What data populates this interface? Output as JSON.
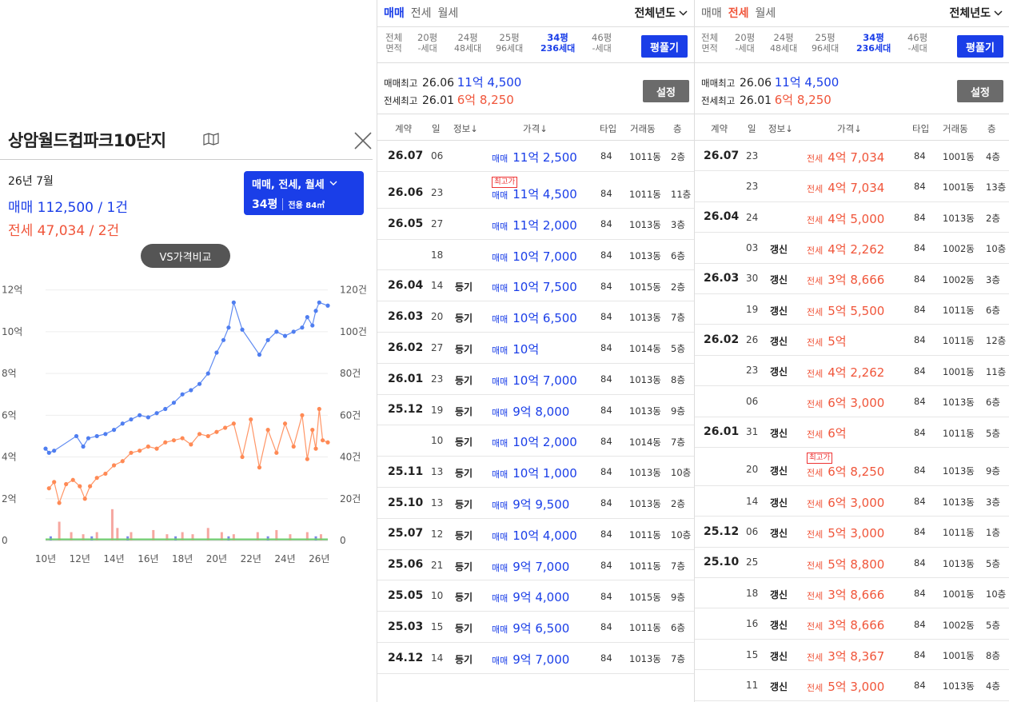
{
  "left": {
    "title": "상암월드컵파크10단지",
    "month": "26년 7월",
    "sale_summary": "매매 112,500 / 1건",
    "jeonse_summary": "전세 47,034 / 2건",
    "type_selector": {
      "label": "매매, 전세, 월세",
      "size": "34평",
      "area": "전용 84㎡"
    },
    "vs_button": "VS가격비교"
  },
  "chart_data": {
    "type": "line",
    "y_left_ticks": [
      "0",
      "2억",
      "4억",
      "6억",
      "8억",
      "10억",
      "12억"
    ],
    "y_right_ticks": [
      "0",
      "20건",
      "40건",
      "60건",
      "80건",
      "100건",
      "120건"
    ],
    "x_ticks": [
      "10년",
      "12년",
      "14년",
      "16년",
      "18년",
      "20년",
      "22년",
      "24년",
      "26년"
    ],
    "ylim_left": [
      0,
      12.6
    ],
    "ylim_right": [
      0,
      126
    ],
    "xlim": [
      2010,
      2026.5
    ],
    "grid": true,
    "colors": {
      "sale": "#4f7ef0",
      "jeonse": "#ff8a55",
      "volume_jeonse": "#f6a7a0",
      "volume_sale": "#7a88e8",
      "volume_other": "#6ccf6c"
    },
    "series": [
      {
        "key": "sale",
        "points": [
          [
            2010.0,
            4.4
          ],
          [
            2010.2,
            4.2
          ],
          [
            2010.5,
            4.3
          ],
          [
            2011.8,
            5.0
          ],
          [
            2012.2,
            4.5
          ],
          [
            2012.5,
            4.9
          ],
          [
            2013.0,
            5.0
          ],
          [
            2013.5,
            5.1
          ],
          [
            2014.0,
            5.3
          ],
          [
            2014.5,
            5.6
          ],
          [
            2015.0,
            5.8
          ],
          [
            2015.5,
            6.0
          ],
          [
            2016.0,
            5.9
          ],
          [
            2016.5,
            6.1
          ],
          [
            2017.0,
            6.3
          ],
          [
            2017.5,
            6.6
          ],
          [
            2018.0,
            7.0
          ],
          [
            2018.5,
            7.2
          ],
          [
            2019.0,
            7.5
          ],
          [
            2019.5,
            8.0
          ],
          [
            2020.0,
            9.0
          ],
          [
            2020.4,
            9.6
          ],
          [
            2020.7,
            10.2
          ],
          [
            2021.0,
            11.4
          ],
          [
            2021.5,
            10.1
          ],
          [
            2022.5,
            8.9
          ],
          [
            2023.0,
            9.6
          ],
          [
            2023.5,
            10.0
          ],
          [
            2024.0,
            9.8
          ],
          [
            2024.5,
            10.0
          ],
          [
            2025.0,
            10.2
          ],
          [
            2025.3,
            10.7
          ],
          [
            2025.6,
            10.3
          ],
          [
            2025.8,
            11.0
          ],
          [
            2026.0,
            11.4
          ],
          [
            2026.5,
            11.25
          ]
        ]
      },
      {
        "key": "jeonse",
        "points": [
          [
            2010.2,
            2.5
          ],
          [
            2010.5,
            2.8
          ],
          [
            2010.8,
            1.8
          ],
          [
            2011.2,
            2.7
          ],
          [
            2011.6,
            2.9
          ],
          [
            2012.0,
            2.6
          ],
          [
            2012.3,
            2.0
          ],
          [
            2012.6,
            2.6
          ],
          [
            2013.0,
            3.0
          ],
          [
            2013.5,
            3.2
          ],
          [
            2014.0,
            3.6
          ],
          [
            2014.5,
            3.8
          ],
          [
            2015.0,
            4.2
          ],
          [
            2015.5,
            4.3
          ],
          [
            2016.0,
            4.5
          ],
          [
            2016.5,
            4.4
          ],
          [
            2017.0,
            4.7
          ],
          [
            2017.5,
            4.8
          ],
          [
            2018.0,
            4.9
          ],
          [
            2018.5,
            4.6
          ],
          [
            2019.0,
            5.1
          ],
          [
            2019.5,
            5.0
          ],
          [
            2020.0,
            5.2
          ],
          [
            2020.5,
            5.4
          ],
          [
            2021.0,
            5.6
          ],
          [
            2021.5,
            4.0
          ],
          [
            2022.0,
            5.8
          ],
          [
            2022.5,
            3.5
          ],
          [
            2023.0,
            5.3
          ],
          [
            2023.5,
            4.2
          ],
          [
            2024.0,
            5.6
          ],
          [
            2024.5,
            4.5
          ],
          [
            2025.0,
            6.0
          ],
          [
            2025.3,
            3.9
          ],
          [
            2025.6,
            5.3
          ],
          [
            2025.8,
            4.4
          ],
          [
            2026.0,
            6.3
          ],
          [
            2026.2,
            4.8
          ],
          [
            2026.5,
            4.7
          ]
        ]
      }
    ],
    "volume": [
      {
        "x": 2010.8,
        "v": 9,
        "key": "jeonse"
      },
      {
        "x": 2011.5,
        "v": 4,
        "key": "jeonse"
      },
      {
        "x": 2012.2,
        "v": 3,
        "key": "jeonse"
      },
      {
        "x": 2013.0,
        "v": 4,
        "key": "jeonse"
      },
      {
        "x": 2013.9,
        "v": 15,
        "key": "jeonse"
      },
      {
        "x": 2014.2,
        "v": 6,
        "key": "jeonse"
      },
      {
        "x": 2015.0,
        "v": 4,
        "key": "jeonse"
      },
      {
        "x": 2016.3,
        "v": 5,
        "key": "jeonse"
      },
      {
        "x": 2017.1,
        "v": 3,
        "key": "jeonse"
      },
      {
        "x": 2018.0,
        "v": 4,
        "key": "jeonse"
      },
      {
        "x": 2018.6,
        "v": 3,
        "key": "jeonse"
      },
      {
        "x": 2019.5,
        "v": 6,
        "key": "jeonse"
      },
      {
        "x": 2020.3,
        "v": 4,
        "key": "jeonse"
      },
      {
        "x": 2021.0,
        "v": 3,
        "key": "jeonse"
      },
      {
        "x": 2022.4,
        "v": 4,
        "key": "jeonse"
      },
      {
        "x": 2023.5,
        "v": 5,
        "key": "jeonse"
      },
      {
        "x": 2024.3,
        "v": 3,
        "key": "jeonse"
      },
      {
        "x": 2025.3,
        "v": 4,
        "key": "jeonse"
      },
      {
        "x": 2026.1,
        "v": 3,
        "key": "jeonse"
      },
      {
        "x": 2010.3,
        "v": 2,
        "key": "sale"
      },
      {
        "x": 2012.7,
        "v": 2,
        "key": "sale"
      },
      {
        "x": 2014.8,
        "v": 2,
        "key": "sale"
      },
      {
        "x": 2017.6,
        "v": 2,
        "key": "sale"
      },
      {
        "x": 2020.7,
        "v": 2,
        "key": "sale"
      },
      {
        "x": 2023.0,
        "v": 2,
        "key": "sale"
      },
      {
        "x": 2025.8,
        "v": 2,
        "key": "sale"
      }
    ]
  },
  "sale_panel": {
    "tabs": [
      "매매",
      "전세",
      "월세"
    ],
    "year_select": "전체년도",
    "size_label_top": "전체",
    "size_label_bottom": "면적",
    "sizes": [
      {
        "py": "20평",
        "units": "-세대"
      },
      {
        "py": "24평",
        "units": "48세대"
      },
      {
        "py": "25평",
        "units": "96세대"
      },
      {
        "py": "34평",
        "units": "236세대"
      },
      {
        "py": "46평",
        "units": "-세대"
      }
    ],
    "area_button": "평풀기",
    "sale_high_label": "매매최고",
    "sale_high_date": "26.06",
    "sale_high_price": "11억 4,500",
    "jeonse_high_label": "전세최고",
    "jeonse_high_date": "26.01",
    "jeonse_high_price": "6억 8,250",
    "settings_button": "설정",
    "headers": [
      "계약",
      "일",
      "정보↓",
      "가격↓",
      "타입",
      "거래동",
      "층"
    ],
    "rows": [
      {
        "ym": "26.07",
        "day": "06",
        "info": "",
        "kind": "매매",
        "price": "11억 2,500",
        "type": "84",
        "dong": "1011동",
        "floor": "2층"
      },
      {
        "ym": "26.06",
        "day": "23",
        "info": "",
        "kind": "매매",
        "price": "11억 4,500",
        "type": "84",
        "dong": "1011동",
        "floor": "11층",
        "badge": "최고가"
      },
      {
        "ym": "26.05",
        "day": "27",
        "info": "",
        "kind": "매매",
        "price": "11억 2,000",
        "type": "84",
        "dong": "1013동",
        "floor": "3층"
      },
      {
        "ym": "",
        "day": "18",
        "info": "",
        "kind": "매매",
        "price": "10억 7,000",
        "type": "84",
        "dong": "1013동",
        "floor": "6층"
      },
      {
        "ym": "26.04",
        "day": "14",
        "info": "등기",
        "kind": "매매",
        "price": "10억 7,500",
        "type": "84",
        "dong": "1015동",
        "floor": "2층"
      },
      {
        "ym": "26.03",
        "day": "20",
        "info": "등기",
        "kind": "매매",
        "price": "10억 6,500",
        "type": "84",
        "dong": "1013동",
        "floor": "7층"
      },
      {
        "ym": "26.02",
        "day": "27",
        "info": "등기",
        "kind": "매매",
        "price": "10억",
        "type": "84",
        "dong": "1014동",
        "floor": "5층"
      },
      {
        "ym": "26.01",
        "day": "23",
        "info": "등기",
        "kind": "매매",
        "price": "10억 7,000",
        "type": "84",
        "dong": "1013동",
        "floor": "8층"
      },
      {
        "ym": "25.12",
        "day": "19",
        "info": "등기",
        "kind": "매매",
        "price": "9억 8,000",
        "type": "84",
        "dong": "1013동",
        "floor": "9층"
      },
      {
        "ym": "",
        "day": "10",
        "info": "등기",
        "kind": "매매",
        "price": "10억 2,000",
        "type": "84",
        "dong": "1014동",
        "floor": "7층"
      },
      {
        "ym": "25.11",
        "day": "13",
        "info": "등기",
        "kind": "매매",
        "price": "10억 1,000",
        "type": "84",
        "dong": "1013동",
        "floor": "10층"
      },
      {
        "ym": "25.10",
        "day": "13",
        "info": "등기",
        "kind": "매매",
        "price": "9억 9,500",
        "type": "84",
        "dong": "1013동",
        "floor": "2층"
      },
      {
        "ym": "25.07",
        "day": "12",
        "info": "등기",
        "kind": "매매",
        "price": "10억 4,000",
        "type": "84",
        "dong": "1011동",
        "floor": "10층"
      },
      {
        "ym": "25.06",
        "day": "21",
        "info": "등기",
        "kind": "매매",
        "price": "9억 7,000",
        "type": "84",
        "dong": "1011동",
        "floor": "7층"
      },
      {
        "ym": "25.05",
        "day": "10",
        "info": "등기",
        "kind": "매매",
        "price": "9억 4,000",
        "type": "84",
        "dong": "1015동",
        "floor": "9층"
      },
      {
        "ym": "25.03",
        "day": "15",
        "info": "등기",
        "kind": "매매",
        "price": "9억 6,500",
        "type": "84",
        "dong": "1011동",
        "floor": "6층"
      },
      {
        "ym": "24.12",
        "day": "14",
        "info": "등기",
        "kind": "매매",
        "price": "9억 7,000",
        "type": "84",
        "dong": "1013동",
        "floor": "7층"
      }
    ]
  },
  "jeonse_panel": {
    "tabs": [
      "매매",
      "전세",
      "월세"
    ],
    "year_select": "전체년도",
    "size_label_top": "전체",
    "size_label_bottom": "면적",
    "sizes": [
      {
        "py": "20평",
        "units": "-세대"
      },
      {
        "py": "24평",
        "units": "48세대"
      },
      {
        "py": "25평",
        "units": "96세대"
      },
      {
        "py": "34평",
        "units": "236세대"
      },
      {
        "py": "46평",
        "units": "-세대"
      }
    ],
    "area_button": "평풀기",
    "sale_high_label": "매매최고",
    "sale_high_date": "26.06",
    "sale_high_price": "11억 4,500",
    "jeonse_high_label": "전세최고",
    "jeonse_high_date": "26.01",
    "jeonse_high_price": "6억 8,250",
    "settings_button": "설정",
    "headers": [
      "계약",
      "일",
      "정보↓",
      "가격↓",
      "타입",
      "거래동",
      "층"
    ],
    "rows": [
      {
        "ym": "26.07",
        "day": "23",
        "info": "",
        "kind": "전세",
        "price": "4억 7,034",
        "type": "84",
        "dong": "1001동",
        "floor": "4층"
      },
      {
        "ym": "",
        "day": "23",
        "info": "",
        "kind": "전세",
        "price": "4억 7,034",
        "type": "84",
        "dong": "1001동",
        "floor": "13층"
      },
      {
        "ym": "26.04",
        "day": "24",
        "info": "",
        "kind": "전세",
        "price": "4억 5,000",
        "type": "84",
        "dong": "1013동",
        "floor": "2층"
      },
      {
        "ym": "",
        "day": "03",
        "info": "갱신",
        "kind": "전세",
        "price": "4억 2,262",
        "type": "84",
        "dong": "1002동",
        "floor": "10층"
      },
      {
        "ym": "26.03",
        "day": "30",
        "info": "갱신",
        "kind": "전세",
        "price": "3억 8,666",
        "type": "84",
        "dong": "1002동",
        "floor": "3층"
      },
      {
        "ym": "",
        "day": "19",
        "info": "갱신",
        "kind": "전세",
        "price": "5억 5,500",
        "type": "84",
        "dong": "1011동",
        "floor": "6층"
      },
      {
        "ym": "26.02",
        "day": "26",
        "info": "갱신",
        "kind": "전세",
        "price": "5억",
        "type": "84",
        "dong": "1011동",
        "floor": "12층"
      },
      {
        "ym": "",
        "day": "23",
        "info": "갱신",
        "kind": "전세",
        "price": "4억 2,262",
        "type": "84",
        "dong": "1001동",
        "floor": "11층"
      },
      {
        "ym": "",
        "day": "06",
        "info": "",
        "kind": "전세",
        "price": "6억 3,000",
        "type": "84",
        "dong": "1013동",
        "floor": "6층"
      },
      {
        "ym": "26.01",
        "day": "31",
        "info": "갱신",
        "kind": "전세",
        "price": "6억",
        "type": "84",
        "dong": "1011동",
        "floor": "5층"
      },
      {
        "ym": "",
        "day": "20",
        "info": "갱신",
        "kind": "전세",
        "price": "6억 8,250",
        "type": "84",
        "dong": "1013동",
        "floor": "9층",
        "badge": "최고가"
      },
      {
        "ym": "",
        "day": "14",
        "info": "갱신",
        "kind": "전세",
        "price": "6억 3,000",
        "type": "84",
        "dong": "1013동",
        "floor": "3층"
      },
      {
        "ym": "25.12",
        "day": "06",
        "info": "갱신",
        "kind": "전세",
        "price": "5억 3,000",
        "type": "84",
        "dong": "1011동",
        "floor": "1층"
      },
      {
        "ym": "25.10",
        "day": "25",
        "info": "",
        "kind": "전세",
        "price": "5억 8,800",
        "type": "84",
        "dong": "1013동",
        "floor": "5층"
      },
      {
        "ym": "",
        "day": "18",
        "info": "갱신",
        "kind": "전세",
        "price": "3억 8,666",
        "type": "84",
        "dong": "1001동",
        "floor": "10층"
      },
      {
        "ym": "",
        "day": "16",
        "info": "갱신",
        "kind": "전세",
        "price": "3억 8,666",
        "type": "84",
        "dong": "1002동",
        "floor": "5층"
      },
      {
        "ym": "",
        "day": "15",
        "info": "갱신",
        "kind": "전세",
        "price": "3억 8,367",
        "type": "84",
        "dong": "1001동",
        "floor": "8층"
      },
      {
        "ym": "",
        "day": "11",
        "info": "갱신",
        "kind": "전세",
        "price": "5억 3,000",
        "type": "84",
        "dong": "1013동",
        "floor": "4층"
      }
    ]
  }
}
